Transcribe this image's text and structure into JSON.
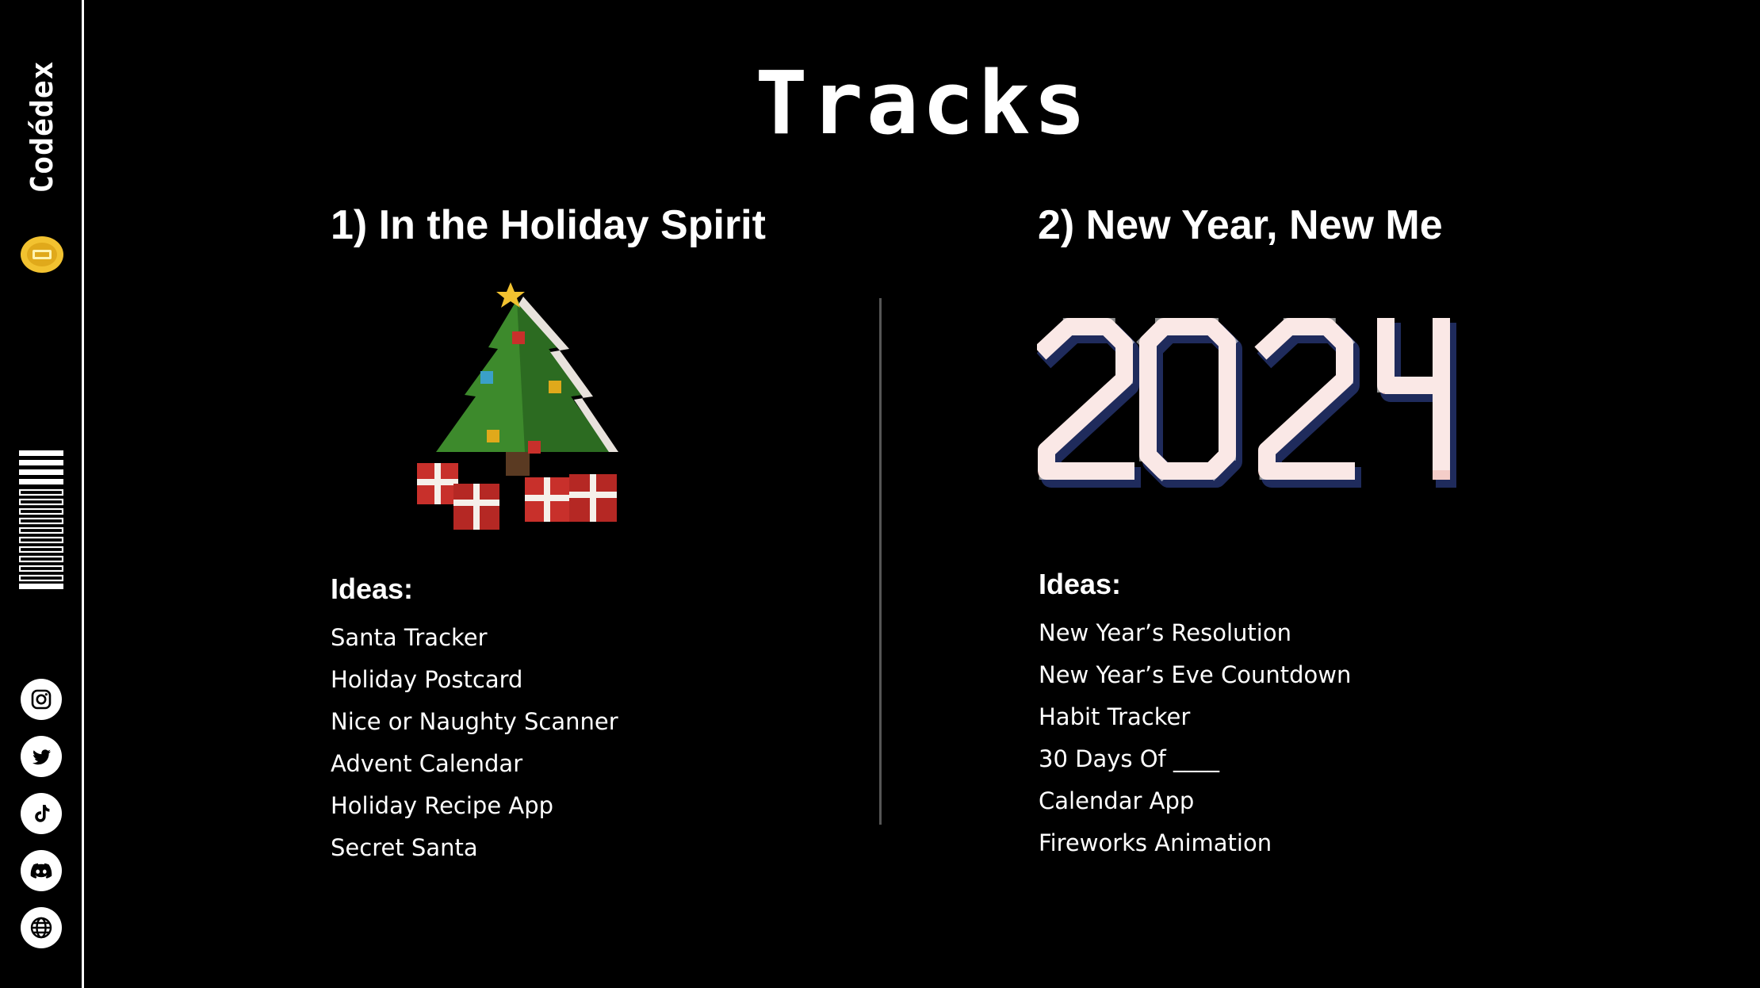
{
  "brand": {
    "name": "Codédex"
  },
  "title": "Tracks",
  "tracks": [
    {
      "heading": "1) In the Holiday Spirit",
      "ideas_label": "Ideas:",
      "ideas": [
        "Santa Tracker",
        "Holiday Postcard",
        "Nice or Naughty Scanner",
        "Advent Calendar",
        "Holiday Recipe App",
        "Secret Santa"
      ]
    },
    {
      "heading": "2) New Year, New Me",
      "ideas_label": "Ideas:",
      "ideas": [
        "New Year’s Resolution",
        "New Year’s Eve Countdown",
        "Habit Tracker",
        "30 Days Of ____",
        "Calendar App",
        "Fireworks Animation"
      ]
    }
  ],
  "social_icons": [
    "instagram-icon",
    "twitter-icon",
    "tiktok-icon",
    "discord-icon",
    "globe-icon"
  ],
  "colors": {
    "background": "#000000",
    "text": "#ffffff",
    "coin": "#f2c230",
    "tree": "#3d8a2c",
    "gift": "#c8302b",
    "block_top": "#f4cdc8",
    "block_side": "#1f2b5c"
  }
}
